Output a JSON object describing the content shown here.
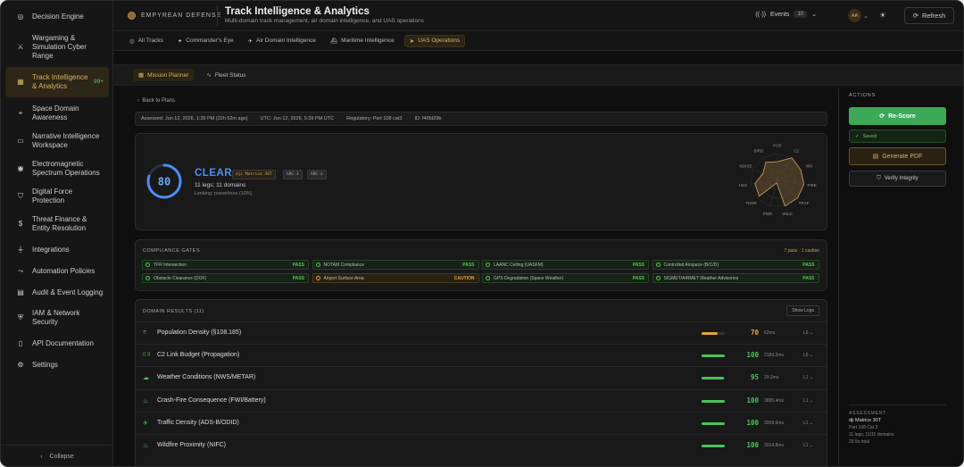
{
  "sidebar": {
    "items": [
      {
        "label": "Decision Engine",
        "icon": "target-icon"
      },
      {
        "label": "Wargaming & Simulation Cyber Range",
        "icon": "crossed-swords-icon"
      },
      {
        "label": "Track Intelligence & Analytics",
        "icon": "grid-icon",
        "badge": "99+",
        "active": true
      },
      {
        "label": "Space Domain Awareness",
        "icon": "satellite-icon"
      },
      {
        "label": "Narrative Intelligence Workspace",
        "icon": "chat-icon"
      },
      {
        "label": "Electromagnetic Spectrum Operations",
        "icon": "radio-icon"
      },
      {
        "label": "Digital Force Protection",
        "icon": "shield-icon"
      },
      {
        "label": "Threat Finance & Entity Resolution",
        "icon": "dollar-icon"
      },
      {
        "label": "Integrations",
        "icon": "plug-icon"
      },
      {
        "label": "Automation Policies",
        "icon": "workflow-icon"
      },
      {
        "label": "Audit & Event Logging",
        "icon": "clipboard-icon"
      },
      {
        "label": "IAM & Network Security",
        "icon": "shield-check-icon"
      },
      {
        "label": "API Documentation",
        "icon": "book-icon"
      },
      {
        "label": "Settings",
        "icon": "gear-icon"
      }
    ],
    "collapse_label": "Collapse"
  },
  "header": {
    "brand": "EMPYREAN DEFENSE",
    "title": "Track Intelligence & Analytics",
    "subtitle": "Multi-domain track management, air domain intelligence, and UAS operations",
    "events_label": "Events",
    "events_count": "10",
    "avatar": "AA",
    "refresh_label": "Refresh"
  },
  "tabs": [
    "All Tracks",
    "Commander's Eye",
    "Air Domain Intelligence",
    "Maritime Intelligence",
    "UAS Operations"
  ],
  "subtabs": [
    "Mission Planner",
    "Fleet Status"
  ],
  "back_label": "Back to Plans",
  "meta": {
    "assessed": "Assessed: Jun 12, 2026, 1:39 PM (22h 52m ago)",
    "utc": "UTC: Jun 12, 2026, 5:39 PM UTC",
    "regulatory": "Regulatory: Part 108 cat3",
    "id": "ID: f46fd29b"
  },
  "summary": {
    "score": "80",
    "score_fraction": 0.8,
    "status": "CLEAR",
    "chips": [
      "dji Matrice 30T",
      "GRC-3",
      "ARC-a"
    ],
    "legs": "11 legs; 11 domains",
    "limiting": "Limiting: powerlines (10%)"
  },
  "radar": {
    "labels": [
      "POP",
      "C2",
      "WX",
      "FIRE",
      "TRAF",
      "WILD",
      "PWR",
      "TERR",
      "H2O",
      "NOISE",
      "BIRD"
    ],
    "values": [
      0.7,
      1.0,
      0.95,
      1.0,
      1.0,
      1.0,
      0.1,
      0.9,
      0.85,
      0.6,
      0.8
    ]
  },
  "compliance": {
    "title": "COMPLIANCE GATES",
    "summary": "7 pass · 1 caution",
    "gates": [
      {
        "name": "TFR Intersection",
        "status": "PASS"
      },
      {
        "name": "NOTAM Compliance",
        "status": "PASS"
      },
      {
        "name": "LAANC Ceiling (UASFM)",
        "status": "PASS"
      },
      {
        "name": "Controlled Airspace (B/C/D)",
        "status": "PASS"
      },
      {
        "name": "Obstacle Clearance (DOF)",
        "status": "PASS"
      },
      {
        "name": "Airport Surface Area",
        "status": "CAUTION"
      },
      {
        "name": "GPS Degradation (Space Weather)",
        "status": "PASS"
      },
      {
        "name": "SIGMET/AIRMET Weather Advisories",
        "status": "PASS"
      }
    ]
  },
  "domain": {
    "title": "DOMAIN RESULTS (11)",
    "show_logs": "Show Logs",
    "rows": [
      {
        "icon": "map-pin-icon",
        "name": "Population Density (§108.185)",
        "score": "70",
        "fill": 0.7,
        "color": "#e0a63c",
        "ms": "62ms",
        "level": "L6"
      },
      {
        "icon": "signal-icon",
        "name": "C2 Link Budget (Propagation)",
        "score": "100",
        "fill": 1.0,
        "color": "#4cc25c",
        "ms": "2189.2ms",
        "level": "L6"
      },
      {
        "icon": "cloud-icon",
        "name": "Weather Conditions (NWS/METAR)",
        "score": "95",
        "fill": 0.95,
        "color": "#4cc25c",
        "ms": "29.2ms",
        "level": "L1"
      },
      {
        "icon": "flame-icon",
        "name": "Crash-Fire Consequence (FWI/Battery)",
        "score": "100",
        "fill": 1.0,
        "color": "#4cc25c",
        "ms": "3885.4ms",
        "level": "L1"
      },
      {
        "icon": "plane-icon",
        "name": "Traffic Density (ADS-B/ODID)",
        "score": "100",
        "fill": 1.0,
        "color": "#4cc25c",
        "ms": "3008.6ms",
        "level": "L1"
      },
      {
        "icon": "flame-icon",
        "name": "Wildfire Proximity (NIFC)",
        "score": "100",
        "fill": 1.0,
        "color": "#4cc25c",
        "ms": "3014.8ms",
        "level": "L1"
      }
    ]
  },
  "actions": {
    "title": "ACTIONS",
    "rescore": "Re-Score",
    "saved": "Saved",
    "pdf": "Generate PDF",
    "verify": "Verify Integrity"
  },
  "assessment": {
    "title": "ASSESSMENT",
    "aircraft": "dji Matrice 30T",
    "category": "Part 108 Cat 3",
    "legs": "11 legs; 11/11 domains",
    "total": "29.5s total"
  },
  "colors": {
    "accent": "#d8b36a",
    "clear": "#4b8ef2",
    "pass": "#5fbf5f",
    "caution": "#d9a54a"
  }
}
